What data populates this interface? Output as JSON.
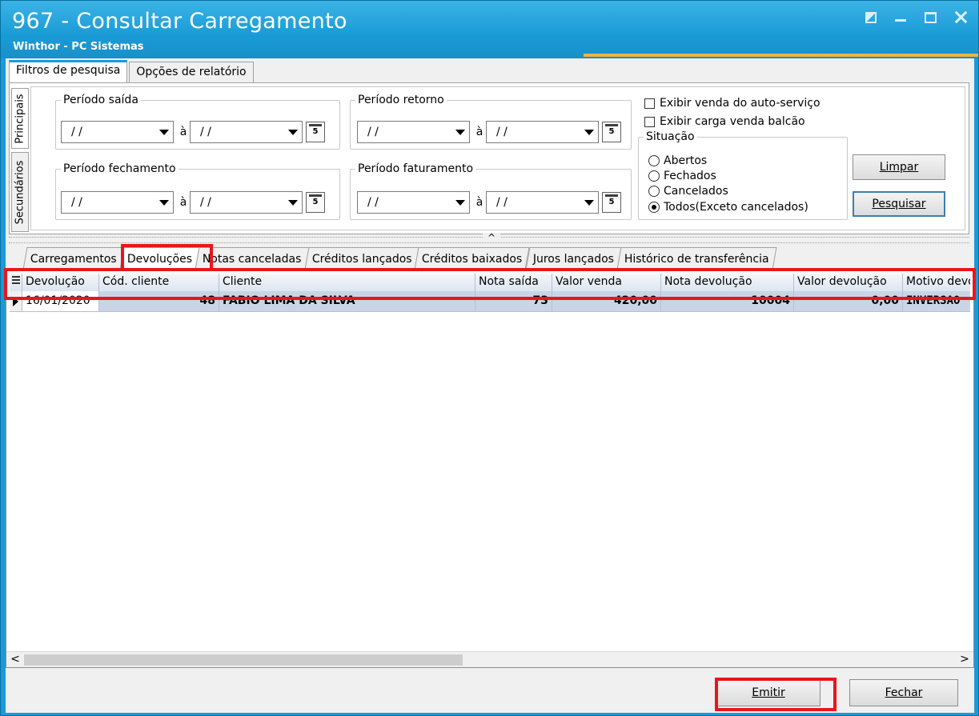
{
  "window": {
    "title": "967 - Consultar Carregamento",
    "subtitle": "Winthor - PC Sistemas"
  },
  "top_tabs": [
    {
      "label": "Filtros de pesquisa",
      "active": true
    },
    {
      "label": "Opções de relatório",
      "active": false
    }
  ],
  "side_tabs": {
    "principais": "Principais",
    "secundarios": "Secundários"
  },
  "filters": {
    "periodo_saida": {
      "legend": "Período saída",
      "from": "/ /",
      "to": "/ /",
      "sep": "à"
    },
    "periodo_retorno": {
      "legend": "Período retorno",
      "from": "/ /",
      "to": "/ /",
      "sep": "à"
    },
    "periodo_fechamento": {
      "legend": "Período fechamento",
      "from": "/ /",
      "to": "/ /",
      "sep": "à"
    },
    "periodo_faturamento": {
      "legend": "Período faturamento",
      "from": "/ /",
      "to": "/ /",
      "sep": "à"
    },
    "calendar_digit": "5"
  },
  "checks": {
    "auto_servico": {
      "label": "Exibir venda do auto-serviço",
      "checked": false
    },
    "venda_balcao": {
      "label": "Exibir carga venda balcão",
      "checked": false
    }
  },
  "situacao": {
    "legend": "Situação",
    "options": [
      {
        "label": "Abertos",
        "selected": false
      },
      {
        "label": "Fechados",
        "selected": false
      },
      {
        "label": "Cancelados",
        "selected": false
      },
      {
        "label": "Todos(Exceto cancelados)",
        "selected": true
      }
    ]
  },
  "buttons": {
    "limpar": "Limpar",
    "pesquisar": "Pesquisar",
    "emitir": "Emitir",
    "fechar": "Fechar"
  },
  "splitter_glyph": "^",
  "bottom_tabs": [
    {
      "label": "Carregamentos",
      "active": false
    },
    {
      "label": "Devoluções",
      "active": true
    },
    {
      "label": "Notas canceladas",
      "active": false
    },
    {
      "label": "Créditos lançados",
      "active": false
    },
    {
      "label": "Créditos baixados",
      "active": false
    },
    {
      "label": "Juros lançados",
      "active": false
    },
    {
      "label": "Histórico de transferência",
      "active": false
    }
  ],
  "grid": {
    "columns": [
      "Devolução",
      "Cód. cliente",
      "Cliente",
      "Nota saída",
      "Valor venda",
      "Nota devolução",
      "Valor devolução",
      "Motivo devo"
    ],
    "rows": [
      [
        "16/01/2020",
        "48",
        "FABIO LIMA DA SILVA",
        "73",
        "420,00",
        "10004",
        "0,00",
        "INVERSAO"
      ]
    ]
  },
  "scroll": {
    "left": "<",
    "right": ">"
  },
  "colors": {
    "title_bar": "#1a9bd6",
    "accent": "#f0b440",
    "highlight": "#e8161b",
    "selected_row": "#c9d5e6"
  }
}
